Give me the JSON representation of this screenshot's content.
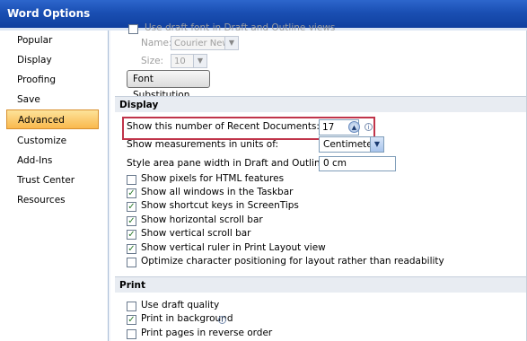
{
  "window": {
    "title": "Word Options"
  },
  "nav": {
    "items": [
      {
        "label": "Popular",
        "selected": false
      },
      {
        "label": "Display",
        "selected": false
      },
      {
        "label": "Proofing",
        "selected": false
      },
      {
        "label": "Save",
        "selected": false
      },
      {
        "label": "Advanced",
        "selected": true
      },
      {
        "label": "Customize",
        "selected": false
      },
      {
        "label": "Add-Ins",
        "selected": false
      },
      {
        "label": "Trust Center",
        "selected": false
      },
      {
        "label": "Resources",
        "selected": false
      }
    ]
  },
  "font_section": {
    "partial_label": "Use draft font in Draft and Outline views",
    "name_label": "Name:",
    "name_value": "Courier New",
    "size_label": "Size:",
    "size_value": "10",
    "font_substitution_button": "Font Substitution..."
  },
  "display_section": {
    "header": "Display",
    "recent_docs_label": "Show this number of Recent Documents:",
    "recent_docs_value": "17",
    "measurements_label": "Show measurements in units of:",
    "measurements_value": "Centimeters",
    "style_area_label": "Style area pane width in Draft and Outline views:",
    "style_area_value": "0 cm",
    "checkboxes": [
      {
        "label": "Show pixels for HTML features",
        "checked": false
      },
      {
        "label": "Show all windows in the Taskbar",
        "checked": true
      },
      {
        "label": "Show shortcut keys in ScreenTips",
        "checked": true
      },
      {
        "label": "Show horizontal scroll bar",
        "checked": true
      },
      {
        "label": "Show vertical scroll bar",
        "checked": true
      },
      {
        "label": "Show vertical ruler in Print Layout view",
        "checked": true
      },
      {
        "label": "Optimize character positioning for layout rather than readability",
        "checked": false
      }
    ]
  },
  "print_section": {
    "header": "Print",
    "checkboxes": [
      {
        "label": "Use draft quality",
        "checked": false
      },
      {
        "label": "Print in background",
        "checked": true
      },
      {
        "label": "Print pages in reverse order",
        "checked": false
      }
    ]
  },
  "icons": {
    "checkmark": "✓",
    "spin_up": "▲",
    "spin_down": "▼",
    "dropdown": "▼",
    "info": "i"
  },
  "colors": {
    "title_bar": "#1a4fb3",
    "selected_nav": "#f9b84d",
    "highlight_border": "#c0344a"
  }
}
